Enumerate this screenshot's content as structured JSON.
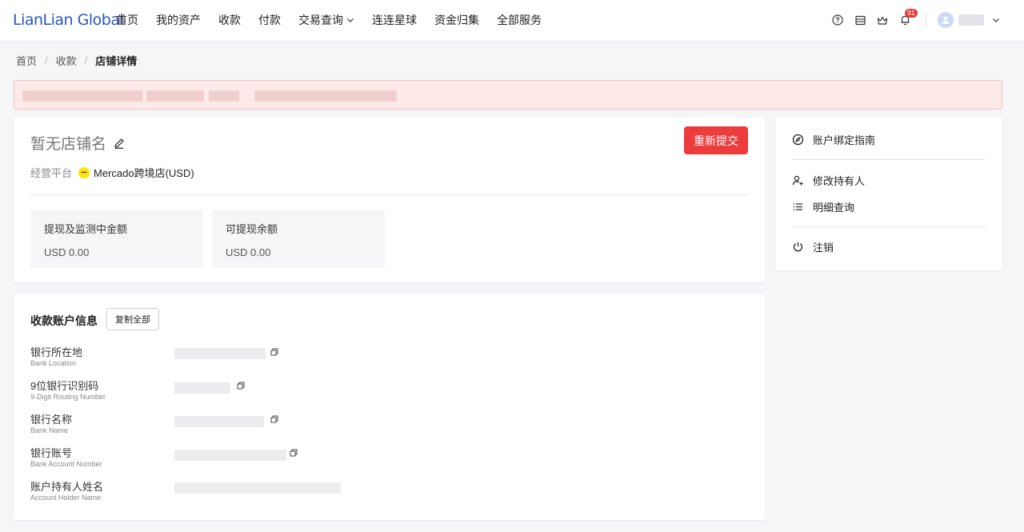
{
  "header": {
    "logo": "LianLian Global",
    "nav": [
      "首页",
      "我的资产",
      "收款",
      "付款",
      "交易查询",
      "连连星球",
      "资金归集",
      "全部服务"
    ],
    "notification_count": "91",
    "icons": [
      "help-icon",
      "calendar-icon",
      "crown-icon",
      "bell-icon",
      "user-avatar-icon"
    ]
  },
  "breadcrumb": {
    "items": [
      "首页",
      "收款"
    ],
    "current": "店铺详情"
  },
  "store": {
    "name": "暂无店铺名",
    "resubmit_label": "重新提交",
    "platform_label": "经营平台",
    "platform_value": "Mercado跨境店(USD)",
    "amounts": [
      {
        "label": "提现及监测中金额",
        "value": "USD 0.00"
      },
      {
        "label": "可提现余额",
        "value": "USD 0.00"
      }
    ]
  },
  "side": {
    "guide": "账户绑定指南",
    "modify_holder": "修改持有人",
    "detail_query": "明细查询",
    "cancel": "注销"
  },
  "account": {
    "title": "收款账户信息",
    "copy_all": "复制全部",
    "rows": [
      {
        "label": "银行所在地",
        "sub": "Bank Location"
      },
      {
        "label": "9位银行识别码",
        "sub": "9-Digit Routing Number"
      },
      {
        "label": "银行名称",
        "sub": "Bank Name"
      },
      {
        "label": "银行账号",
        "sub": "Bank Account Number"
      },
      {
        "label": "账户持有人姓名",
        "sub": "Account Holder Name"
      }
    ]
  },
  "colors": {
    "brand": "#2a56c6",
    "danger": "#ec3c3c",
    "alert_bg": "#fde9e7"
  }
}
